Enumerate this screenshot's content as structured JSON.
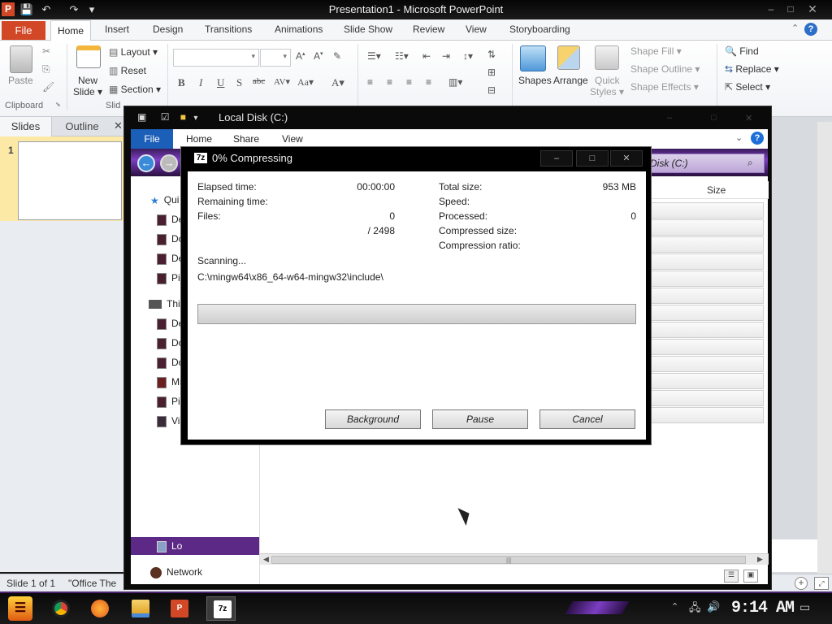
{
  "powerpoint": {
    "title": "Presentation1  -  Microsoft PowerPoint",
    "logo": "P",
    "qat": {
      "save_icon": "save-icon",
      "undo_icon": "undo-icon",
      "redo_icon": "redo-icon",
      "dropdown_icon": "chevron-down-icon"
    },
    "window": {
      "min": "–",
      "max": "□",
      "close": "✕"
    },
    "tabs": [
      "File",
      "Home",
      "Insert",
      "Design",
      "Transitions",
      "Animations",
      "Slide Show",
      "Review",
      "View",
      "Storyboarding"
    ],
    "help": "?",
    "ribbon": {
      "paste": "Paste",
      "clipboard": "Clipboard",
      "new_slide": "New Slide",
      "new_slide_line1": "New",
      "new_slide_line2": "Slide ▾",
      "layout": "Layout ▾",
      "reset": "Reset",
      "section": "Section ▾",
      "slides_group": "Slid",
      "shapes": "Shapes",
      "arrange": "Arrange",
      "quick_styles_line1": "Quick",
      "quick_styles_line2": "Styles ▾",
      "shape_fill": "Shape Fill ▾",
      "shape_outline": "Shape Outline ▾",
      "shape_effects": "Shape Effects ▾",
      "find": "Find",
      "replace": "Replace ▾",
      "select": "Select ▾",
      "format_buttons": [
        "B",
        "I",
        "U",
        "S",
        "abc",
        "AV▾",
        "Aa▾",
        "A▾"
      ]
    },
    "pane": {
      "slides_tab": "Slides",
      "outline_tab": "Outline",
      "close": "✕",
      "slide_number": "1"
    },
    "status": {
      "slide": "Slide 1 of 1",
      "theme": "\"Office The"
    }
  },
  "explorer": {
    "title": "Local Disk (C:)",
    "tabs": {
      "file": "File",
      "home": "Home",
      "share": "Share",
      "view": "View"
    },
    "help": "?",
    "search_placeholder": "Search Local Disk (C:)",
    "search_visible": "Disk (C:)",
    "column_size": "Size",
    "nav": [
      {
        "label": "Qui",
        "icon": "star-icon"
      },
      {
        "label": "De",
        "icon": "folder-icon"
      },
      {
        "label": "Do",
        "icon": "folder-icon"
      },
      {
        "label": "De",
        "icon": "folder-icon"
      },
      {
        "label": "Pi",
        "icon": "folder-icon"
      },
      {
        "label": "Thi",
        "icon": "computer-icon"
      },
      {
        "label": "De",
        "icon": "folder-icon"
      },
      {
        "label": "Do",
        "icon": "folder-icon"
      },
      {
        "label": "Do",
        "icon": "folder-icon"
      },
      {
        "label": "Mi",
        "icon": "music-icon"
      },
      {
        "label": "Pi",
        "icon": "folder-icon"
      },
      {
        "label": "Vi",
        "icon": "video-icon"
      },
      {
        "label": "Lo",
        "icon": "drive-icon"
      },
      {
        "label": "Network",
        "icon": "network-icon"
      }
    ]
  },
  "zip": {
    "icon_label": "7z",
    "title": "0% Compressing",
    "progress_fraction": 0,
    "fields": {
      "elapsed_label": "Elapsed time:",
      "elapsed_value": "00:00:00",
      "remaining_label": "Remaining time:",
      "files_label": "Files:",
      "files_value": "0",
      "files_total": "/ 2498",
      "total_size_label": "Total size:",
      "total_size_value": "953 MB",
      "speed_label": "Speed:",
      "processed_label": "Processed:",
      "processed_value": "0",
      "compressed_size_label": "Compressed size:",
      "compression_ratio_label": "Compression ratio:"
    },
    "status": "Scanning...",
    "path": "C:\\mingw64\\x86_64-w64-mingw32\\include\\",
    "buttons": {
      "background": "Background",
      "pause": "Pause",
      "cancel": "Cancel"
    },
    "window": {
      "min": "–",
      "max": "□",
      "close": "✕"
    }
  },
  "taskbar": {
    "apps": [
      {
        "name": "chrome",
        "icon": "chrome-icon"
      },
      {
        "name": "firefox",
        "icon": "firefox-icon"
      },
      {
        "name": "explorer",
        "icon": "folder-icon"
      },
      {
        "name": "powerpoint",
        "icon": "powerpoint-icon"
      },
      {
        "name": "7zip",
        "icon": "7zip-icon",
        "label": "7z"
      }
    ],
    "clock": "9:14 AM"
  }
}
